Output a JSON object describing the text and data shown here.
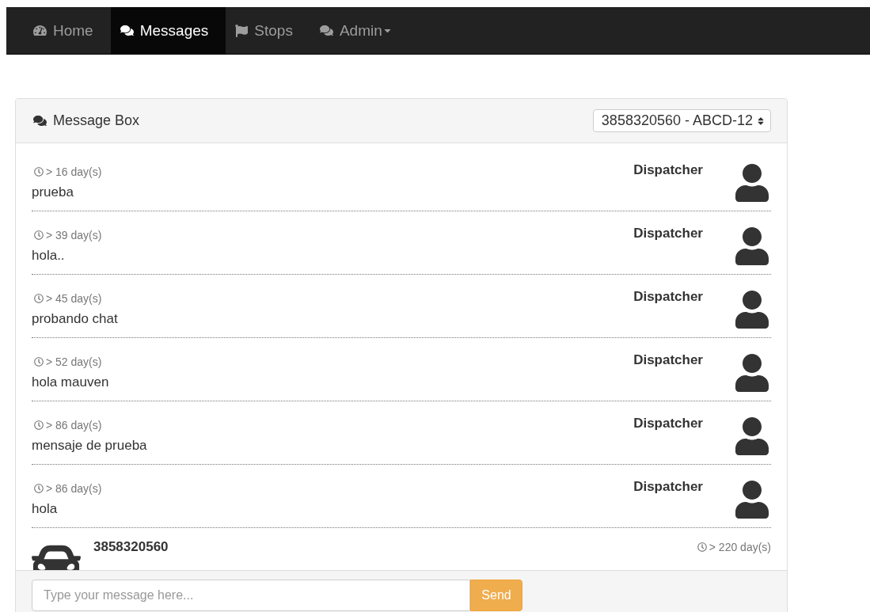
{
  "nav": {
    "items": [
      {
        "label": "Home",
        "selected": false,
        "dropdown": false
      },
      {
        "label": "Messages",
        "selected": true,
        "dropdown": false
      },
      {
        "label": "Stops",
        "selected": false,
        "dropdown": false
      },
      {
        "label": "Admin",
        "selected": false,
        "dropdown": true
      }
    ]
  },
  "panel": {
    "title": "Message Box",
    "selector": {
      "value": "3858320560 - ABCD-12"
    }
  },
  "messages": [
    {
      "time": "> 16 day(s)",
      "text": "prueba",
      "sender": "Dispatcher"
    },
    {
      "time": "> 39 day(s)",
      "text": "hola..",
      "sender": "Dispatcher"
    },
    {
      "time": "> 45 day(s)",
      "text": "probando chat",
      "sender": "Dispatcher"
    },
    {
      "time": "> 52 day(s)",
      "text": "hola mauven",
      "sender": "Dispatcher"
    },
    {
      "time": "> 86 day(s)",
      "text": "mensaje de prueba",
      "sender": "Dispatcher"
    },
    {
      "time": "> 86 day(s)",
      "text": "hola",
      "sender": "Dispatcher"
    }
  ],
  "vehicle_message": {
    "sender": "3858320560",
    "time": "> 220 day(s)"
  },
  "composer": {
    "placeholder": "Type your message here...",
    "button": "Send"
  }
}
